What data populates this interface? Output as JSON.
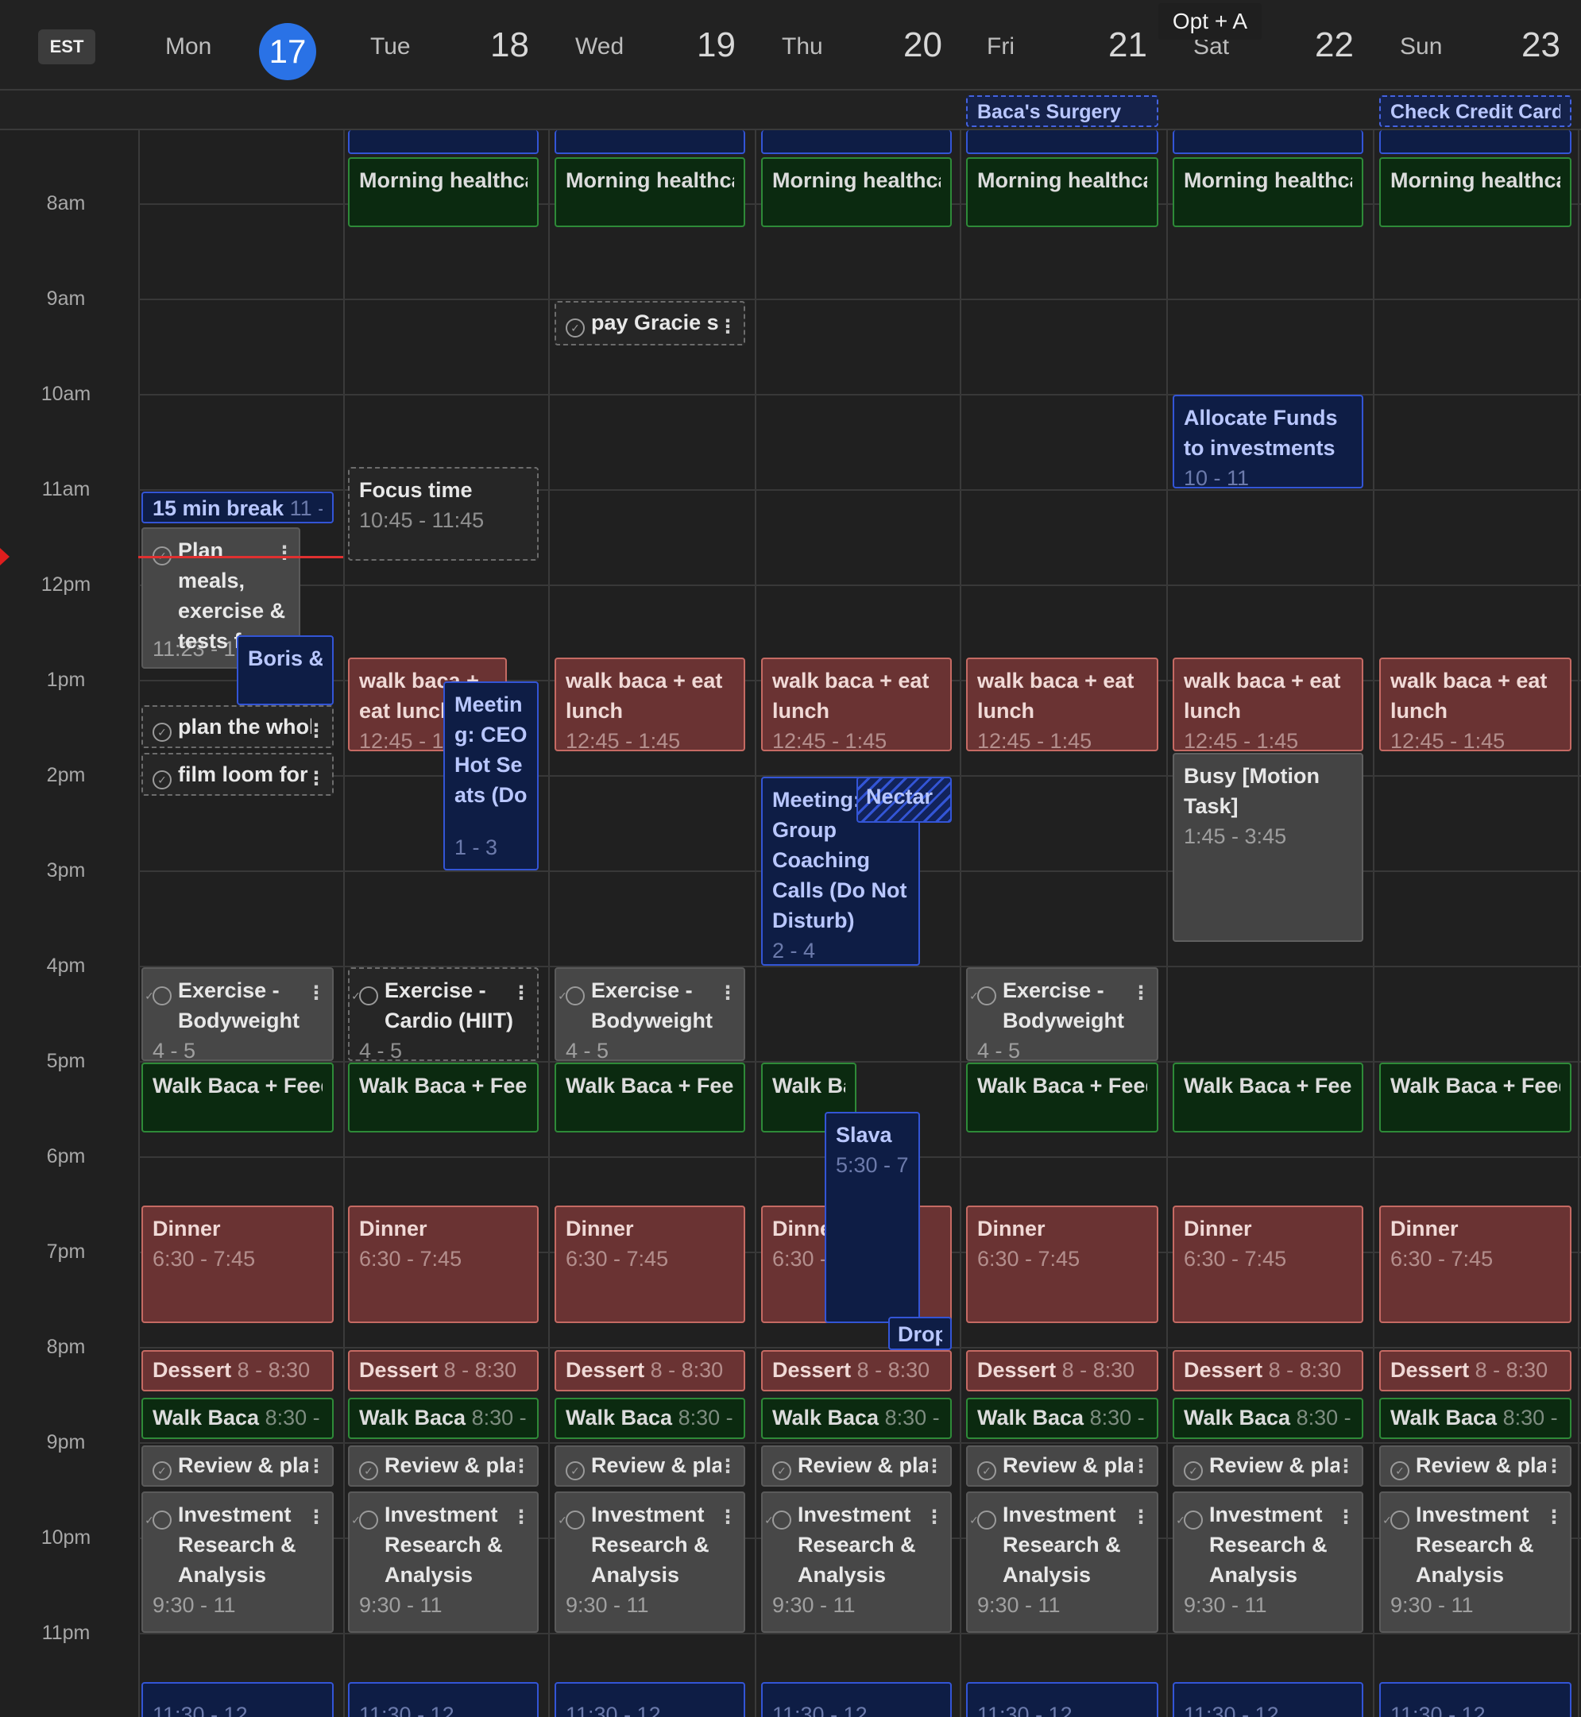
{
  "timezone": "EST",
  "keyboard_hint": "Opt + A",
  "days": [
    {
      "weekday": "Mon",
      "date": "17",
      "today": true
    },
    {
      "weekday": "Tue",
      "date": "18"
    },
    {
      "weekday": "Wed",
      "date": "19"
    },
    {
      "weekday": "Thu",
      "date": "20"
    },
    {
      "weekday": "Fri",
      "date": "21"
    },
    {
      "weekday": "Sat",
      "date": "22"
    },
    {
      "weekday": "Sun",
      "date": "23"
    }
  ],
  "all_day": {
    "fri": "Baca's Surgery",
    "sun": "Check Credit Cards"
  },
  "hours": [
    "8am",
    "9am",
    "10am",
    "11am",
    "12pm",
    "1pm",
    "2pm",
    "3pm",
    "4pm",
    "5pm",
    "6pm",
    "7pm",
    "8pm",
    "9pm",
    "10pm",
    "11pm"
  ],
  "events": {
    "morning": "Morning healthcare",
    "pay": "pay Gracie s",
    "allocate_title": "Allocate Funds to investments",
    "allocate_time": "10 - 11",
    "break_title": "15 min break",
    "break_time": "11 -",
    "focus_title": "Focus time",
    "focus_time": "10:45 - 11:45",
    "plan_title": "Plan meals, exercise & tests f...",
    "plan_time": "11:23 - 1",
    "boris": "Boris &",
    "walk_lunch": "walk baca + eat lunch",
    "walk_lunch_time": "12:45 - 1:45",
    "tue_walk_time": "12:45 - 1",
    "meeting_ceo": "Meeting: CEO Hot Seats (Do",
    "meeting_ceo_time": "1 - 3",
    "plan_whole": "plan the whole",
    "film_loom": "film loom for",
    "busy_title": "Busy [Motion Task]",
    "busy_time": "1:45 - 3:45",
    "meeting_group": "Meeting: Group Coaching Calls (Do Not Disturb)",
    "meeting_group_time": "2 - 4",
    "nectar": "Nectar",
    "exercise_body": "Exercise - Bodyweight",
    "exercise_cardio": "Exercise - Cardio (HIIT)",
    "exercise_time": "4 - 5",
    "walk_feed": "Walk Baca + Feed",
    "walk_feed_short": "Walk Ba",
    "slava_title": "Slava",
    "slava_time": "5:30 - 7",
    "dinner": "Dinner",
    "dinner_time": "6:30 - 7:45",
    "dinner_short": "Dinne",
    "dinner_time_short": "6:30 -",
    "drop": "Drop",
    "dessert": "Dessert",
    "dessert_time": "8 - 8:30",
    "walk_baca": "Walk Baca",
    "walk_baca_time": "8:30 - 9",
    "review": "Review & plan",
    "invest": "Investment Research & Analysis",
    "invest_time": "9:30 - 11",
    "sleep_time": "11:30 - 12"
  },
  "colors": {
    "today_accent": "#2a72e6",
    "current_time": "#e03030"
  }
}
